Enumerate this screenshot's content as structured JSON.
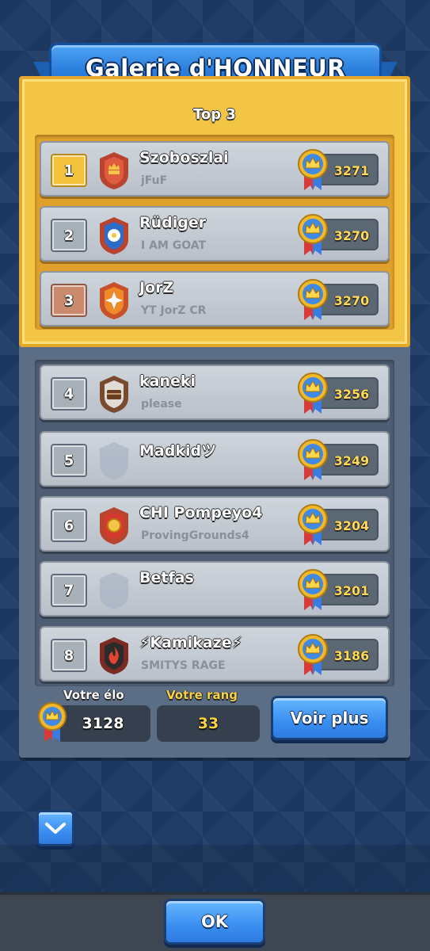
{
  "title": "Galerie d'HONNEUR",
  "top3_label": "Top 3",
  "rows": [
    {
      "rank": "1",
      "name": "Szoboszlai",
      "clan": "jFuF",
      "trophies": "3271",
      "rank_style": "gold-r",
      "badge": "crest-red-gold"
    },
    {
      "rank": "2",
      "name": "Rüdiger",
      "clan": "I AM GOAT",
      "trophies": "3270",
      "rank_style": "silver",
      "badge": "crest-blue-flower"
    },
    {
      "rank": "3",
      "name": "JorZ",
      "clan": "YT JorZ CR",
      "trophies": "3270",
      "rank_style": "bronze",
      "badge": "crest-orange-star"
    },
    {
      "rank": "4",
      "name": "kaneki",
      "clan": "please",
      "trophies": "3256",
      "rank_style": "normal",
      "badge": "crest-brown-chest"
    },
    {
      "rank": "5",
      "name": "Madkidツ",
      "clan": "",
      "trophies": "3249",
      "rank_style": "normal",
      "badge": "crest-empty"
    },
    {
      "rank": "6",
      "name": "CHI Pompeyo4",
      "clan": "ProvingGrounds4",
      "trophies": "3204",
      "rank_style": "normal",
      "badge": "crest-red-coin"
    },
    {
      "rank": "7",
      "name": "Betfas",
      "clan": "",
      "trophies": "3201",
      "rank_style": "normal",
      "badge": "crest-empty"
    },
    {
      "rank": "8",
      "name": "⚡Kamikaze⚡",
      "clan": "SMITYS RAGE",
      "trophies": "3186",
      "rank_style": "normal",
      "badge": "crest-black-fire"
    }
  ],
  "footer": {
    "elo_label": "Votre élo",
    "elo_value": "3128",
    "rang_label": "Votre rang",
    "rang_value": "33",
    "voir_plus": "Voir plus"
  },
  "ok_label": "OK",
  "icons": {
    "scroll_down": "chevron-down-icon",
    "trophy_medal": "crown-medal-icon"
  },
  "colors": {
    "gold_panel": "#f3c544",
    "blue_button": "#3a8ef0",
    "trophy_text": "#ffd95a",
    "rang_text": "#f6d24a"
  }
}
